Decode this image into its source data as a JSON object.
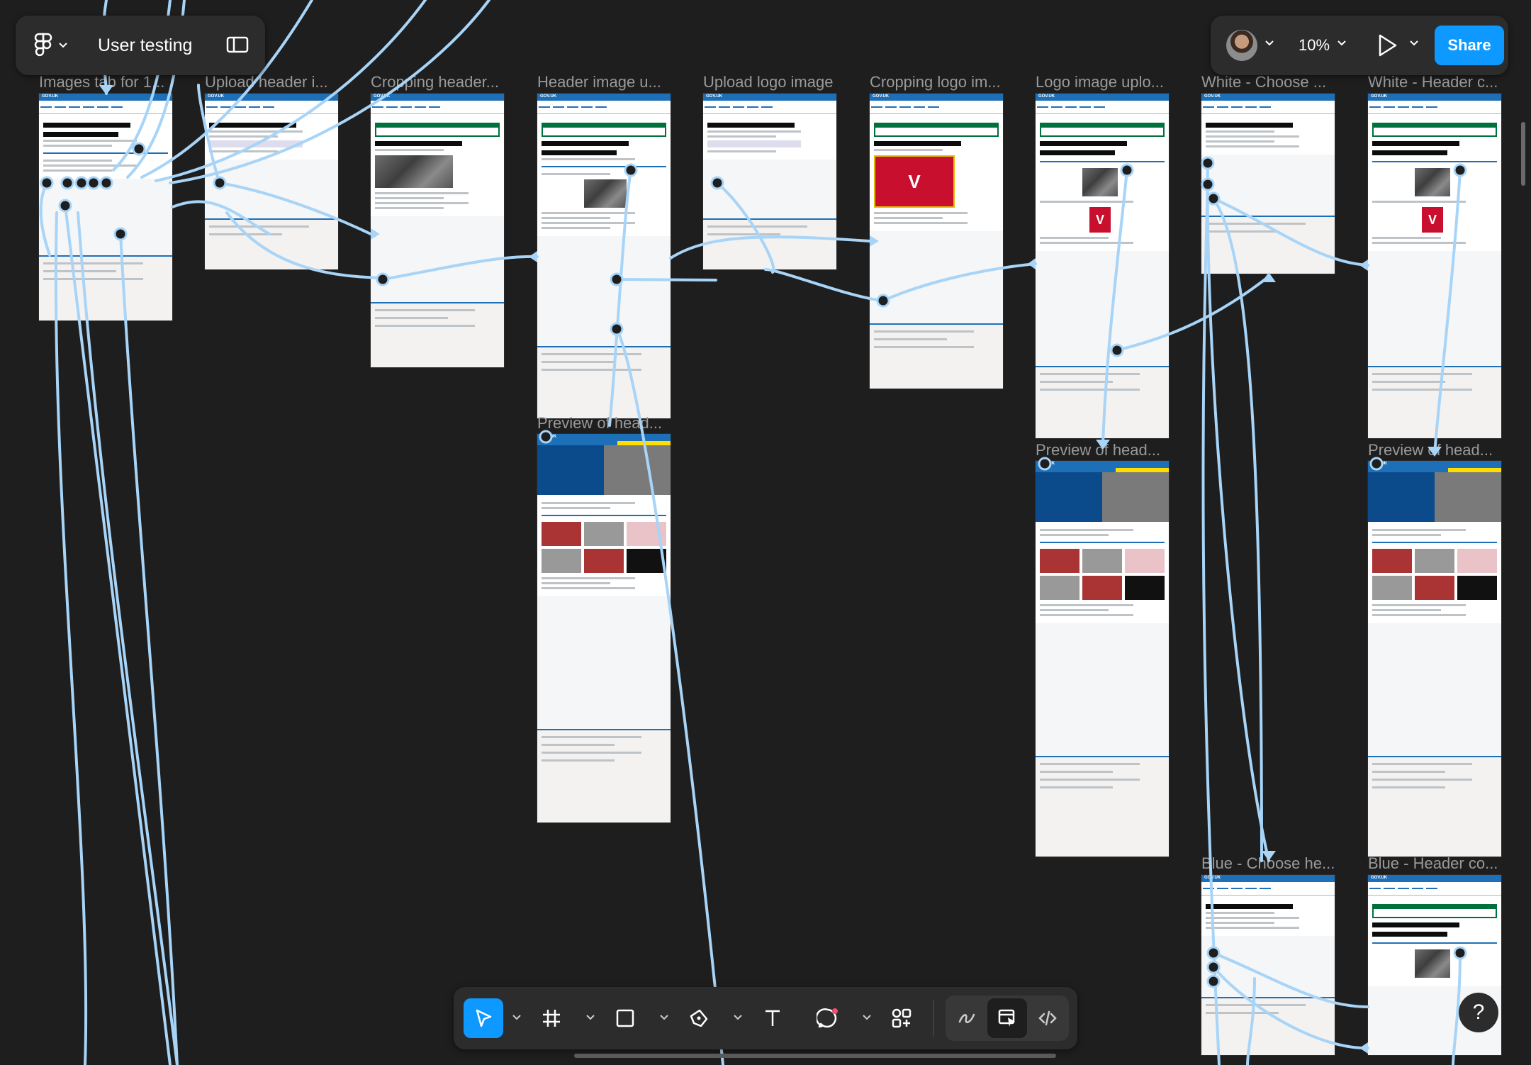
{
  "file": {
    "name": "User testing"
  },
  "toolbar_right": {
    "zoom": "10%",
    "share_label": "Share"
  },
  "help": {
    "label": "?"
  },
  "frames": [
    {
      "label": "Images tab for 1..."
    },
    {
      "label": "Upload header i..."
    },
    {
      "label": "Cropping header..."
    },
    {
      "label": "Header image u..."
    },
    {
      "label": "Upload logo image"
    },
    {
      "label": "Cropping logo im..."
    },
    {
      "label": "Logo image uplo..."
    },
    {
      "label": "White - Choose ..."
    },
    {
      "label": "White - Header c..."
    },
    {
      "label": "Preview of head..."
    },
    {
      "label": "Preview of head..."
    },
    {
      "label": "Preview of head..."
    },
    {
      "label": "Blue - Choose he..."
    },
    {
      "label": "Blue - Header co..."
    }
  ],
  "frame_text": {
    "gov_uk": "GOV.UK",
    "logo_v": "V"
  },
  "tools": [
    {
      "name": "move-tool",
      "icon": "cursor-icon"
    },
    {
      "name": "frame-tool",
      "icon": "hash-frame-icon"
    },
    {
      "name": "shape-tool",
      "icon": "rectangle-icon"
    },
    {
      "name": "pen-tool",
      "icon": "pen-icon"
    },
    {
      "name": "text-tool",
      "icon": "text-icon"
    },
    {
      "name": "comment-tool",
      "icon": "comment-icon"
    },
    {
      "name": "actions-tool",
      "icon": "components-icon"
    },
    {
      "name": "draw-mode",
      "icon": "draw-icon"
    },
    {
      "name": "design-mode",
      "icon": "design-icon"
    },
    {
      "name": "dev-mode",
      "icon": "code-icon"
    }
  ],
  "colors": {
    "accent": "#0d99ff",
    "canvas": "#1e1e1e",
    "wire": "#a7d4f7",
    "gov_blue": "#1d70b8"
  }
}
